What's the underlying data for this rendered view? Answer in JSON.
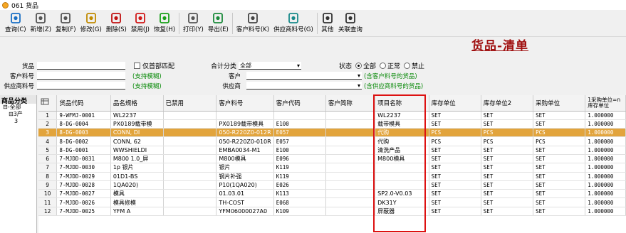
{
  "window": {
    "title": "061 货品"
  },
  "toolbar": [
    {
      "label": "查询(C)",
      "icon": "search-icon",
      "color": "#1a6fc4"
    },
    {
      "label": "新增(Z)",
      "icon": "new-doc-icon",
      "color": "#555555"
    },
    {
      "label": "复制(F)",
      "icon": "copy-icon",
      "color": "#555555"
    },
    {
      "label": "修改(G)",
      "icon": "edit-icon",
      "color": "#c08a00"
    },
    {
      "label": "删除(S)",
      "icon": "delete-icon",
      "color": "#c01010"
    },
    {
      "label": "禁用(J)",
      "icon": "disable-icon",
      "color": "#d01818"
    },
    {
      "label": "恢复(H)",
      "icon": "restore-icon",
      "color": "#18a018"
    },
    {
      "label": "打印(Y)",
      "icon": "print-icon",
      "color": "#555555"
    },
    {
      "label": "导出(E)",
      "icon": "export-icon",
      "color": "#1a8a3a"
    },
    {
      "label": "客户料号(K)",
      "icon": "customer-icon",
      "color": "#444444"
    },
    {
      "label": "供应商料号(G)",
      "icon": "supplier-icon",
      "color": "#1a8a8a"
    },
    {
      "label": "其他",
      "icon": "other-icon",
      "color": "#333333"
    },
    {
      "label": "关联查询",
      "icon": "link-icon",
      "color": "#333333"
    }
  ],
  "page_title": "货品-清单",
  "filters": {
    "goods_label": "货品",
    "only_head": "仅首部匹配",
    "customer_code_label": "客户料号",
    "supplier_code_label": "供应商料号",
    "fuzzy_hint": "(支持模糊)",
    "sum_label": "合计分类",
    "sum_value": "全部",
    "customer_label": "客户",
    "supplier_label": "供应商",
    "customer_hint": "(含客户料号的货品)",
    "supplier_hint": "(含供应商料号的货品)",
    "status_label": "状态",
    "status_options": [
      "全部",
      "正常",
      "禁止"
    ],
    "status_selected": "全部"
  },
  "left_panel": {
    "title": "商品分类",
    "tree": [
      "全部",
      "3产",
      "3"
    ]
  },
  "table": {
    "columns": [
      "货品代码",
      "品名规格",
      "已禁用",
      "客户料号",
      "客户代码",
      "客户简称",
      "项目名称",
      "库存单位",
      "库存单位2",
      "采购单位",
      "1采购单位=n库存单位"
    ],
    "rows": [
      {
        "n": "1",
        "code": "9-WFMJ-0001",
        "spec": "WL2237",
        "dis": "",
        "cpn": "",
        "cc": "",
        "cs": "",
        "proj": "WL2237",
        "u1": "SET",
        "u2": "SET",
        "pu": "SET",
        "ratio": "1.000000"
      },
      {
        "n": "2",
        "code": "8-DG-0004",
        "spec": "PX0189载带模",
        "dis": "",
        "cpn": "PX0189载带模具",
        "cc": "E100",
        "cs": "",
        "proj": "载带模具",
        "u1": "SET",
        "u2": "SET",
        "pu": "SET",
        "ratio": "1.000000"
      },
      {
        "n": "3",
        "code": "8-DG-0003",
        "spec": "CONN, DI",
        "dis": "",
        "cpn": "050-R220Z0-012R",
        "cc": "E057",
        "cs": "",
        "proj": "代购",
        "u1": "PCS",
        "u2": "PCS",
        "pu": "PCS",
        "ratio": "1.000000"
      },
      {
        "n": "4",
        "code": "8-DG-0002",
        "spec": "CONN, 62",
        "dis": "",
        "cpn": "050-R220Z0-010R",
        "cc": "E057",
        "cs": "",
        "proj": "代购",
        "u1": "PCS",
        "u2": "PCS",
        "pu": "PCS",
        "ratio": "1.000000"
      },
      {
        "n": "5",
        "code": "8-DG-0001",
        "spec": "WWSHIELDI",
        "dis": "",
        "cpn": "EMBA0034-M1",
        "cc": "E100",
        "cs": "",
        "proj": "清洗产品",
        "u1": "SET",
        "u2": "SET",
        "pu": "SET",
        "ratio": "1.000000"
      },
      {
        "n": "6",
        "code": "7-MJDD-0031",
        "spec": "M800 1.0_屏",
        "dis": "",
        "cpn": "M800模具",
        "cc": "E096",
        "cs": "",
        "proj": "M800模具",
        "u1": "SET",
        "u2": "SET",
        "pu": "SET",
        "ratio": "1.000000"
      },
      {
        "n": "7",
        "code": "7-MJDD-0030",
        "spec": "1p 银片",
        "dis": "",
        "cpn": "银片",
        "cc": "K119",
        "cs": "",
        "proj": "",
        "u1": "SET",
        "u2": "SET",
        "pu": "SET",
        "ratio": "1.000000"
      },
      {
        "n": "8",
        "code": "7-MJDD-0029",
        "spec": "01D1-BS",
        "dis": "",
        "cpn": "钢片补强",
        "cc": "K119",
        "cs": "",
        "proj": "",
        "u1": "SET",
        "u2": "SET",
        "pu": "SET",
        "ratio": "1.000000"
      },
      {
        "n": "9",
        "code": "7-MJDD-0028",
        "spec": "1QA020)",
        "dis": "",
        "cpn": "P10(1QA020)",
        "cc": "E026",
        "cs": "",
        "proj": "",
        "u1": "SET",
        "u2": "SET",
        "pu": "SET",
        "ratio": "1.000000"
      },
      {
        "n": "10",
        "code": "7-MJDD-0027",
        "spec": "模具",
        "dis": "",
        "cpn": "01.03.01",
        "cc": "K113",
        "cs": "",
        "proj": "SP2.0-V0.03",
        "u1": "SET",
        "u2": "SET",
        "pu": "SET",
        "ratio": "1.000000"
      },
      {
        "n": "11",
        "code": "7-MJDD-0026",
        "spec": "模具修模",
        "dis": "",
        "cpn": "TH-COST",
        "cc": "E068",
        "cs": "",
        "proj": "DK31Y",
        "u1": "SET",
        "u2": "SET",
        "pu": "SET",
        "ratio": "1.000000"
      },
      {
        "n": "12",
        "code": "7-MJDD-0025",
        "spec": "YFM A",
        "dis": "",
        "cpn": "YFM06000027A0",
        "cc": "K109",
        "cs": "",
        "proj": "屏蔽器",
        "u1": "SET",
        "u2": "SET",
        "pu": "SET",
        "ratio": "1.000000"
      }
    ],
    "selected_row": "3"
  }
}
